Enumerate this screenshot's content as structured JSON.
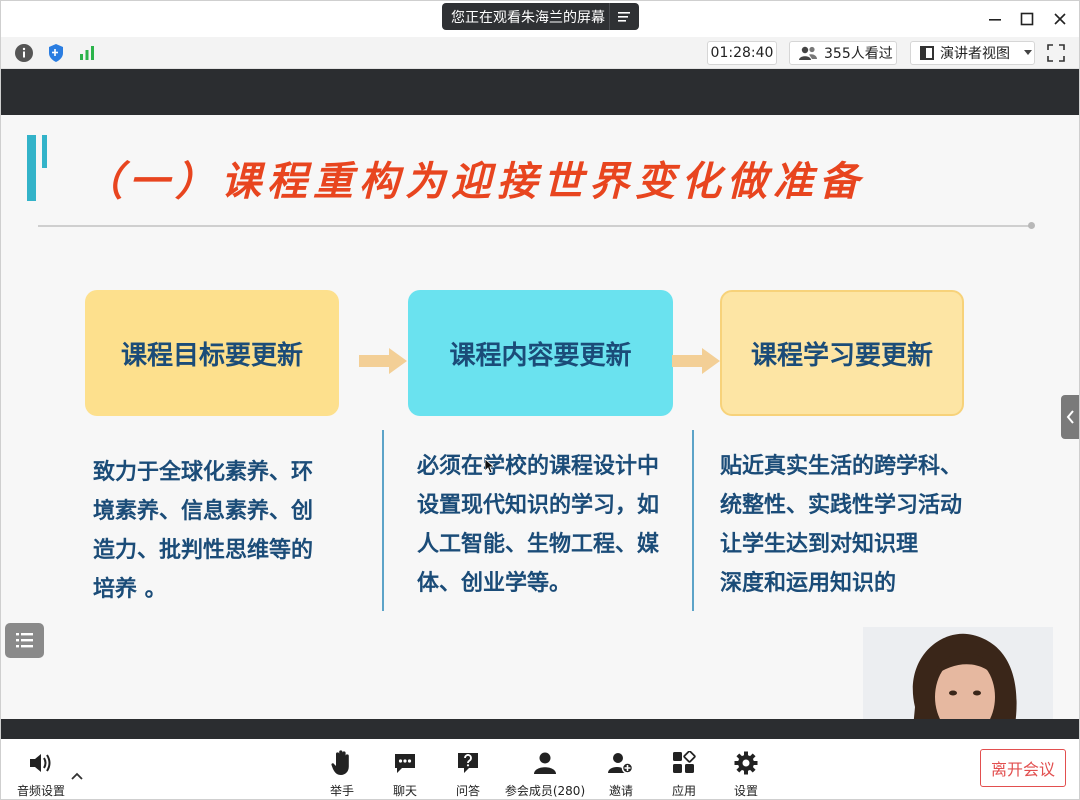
{
  "titlebar": {
    "share_notice": "您正在观看朱海兰的屏幕"
  },
  "toolbar": {
    "timer": "01:28:40",
    "viewers": "355人看过",
    "view_mode": "演讲者视图"
  },
  "slide": {
    "title": "（一）课程重构为迎接世界变化做准备",
    "boxes": [
      {
        "label": "课程目标要更新"
      },
      {
        "label": "课程内容要更新"
      },
      {
        "label": "课程学习要更新"
      }
    ],
    "columns": [
      {
        "lines": [
          "致力于全球化素养、环",
          "境素养、信息素养、创",
          "造力、批判性思维等的",
          "培养 。"
        ]
      },
      {
        "lines": [
          "必须在学校的课程设计中",
          "设置现代知识的学习，如",
          "人工智能、生物工程、媒",
          "体、创业学等。"
        ]
      },
      {
        "lines": [
          "贴近真实生活的跨学科、",
          "统整性、实践性学习活动",
          "让学生达到对知识理",
          "深度和运用知识的"
        ]
      }
    ]
  },
  "bottombar": {
    "audio_settings": "音频设置",
    "raise_hand": "举手",
    "chat": "聊天",
    "qa": "问答",
    "participants": "参会成员(280)",
    "invite": "邀请",
    "apps": "应用",
    "settings": "设置",
    "leave": "离开会议"
  },
  "colors": {
    "title_red": "#e8451f",
    "accent_teal": "#33b3c9",
    "text_blue": "#1b4c78",
    "leave_red": "#e24f4f"
  }
}
